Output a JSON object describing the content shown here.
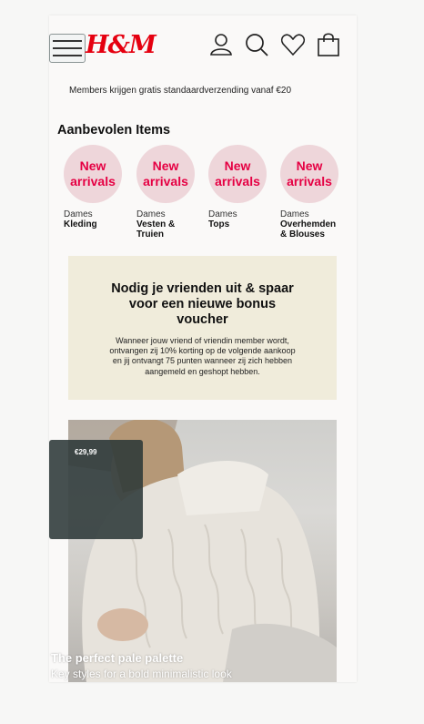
{
  "header": {
    "logo": "H&M",
    "icons": [
      "menu-icon",
      "account-icon",
      "search-icon",
      "heart-icon",
      "shopping-bag-icon"
    ]
  },
  "promo_text": "Members krijgen gratis standaardverzending vanaf €20",
  "recommended": {
    "title": "Aanbevolen Items",
    "items": [
      {
        "badge_line1": "New",
        "badge_line2": "arrivals",
        "category": "Dames",
        "name": "Kleding"
      },
      {
        "badge_line1": "New",
        "badge_line2": "arrivals",
        "category": "Dames",
        "name": "Vesten & Truien"
      },
      {
        "badge_line1": "New",
        "badge_line2": "arrivals",
        "category": "Dames",
        "name": "Tops"
      },
      {
        "badge_line1": "New",
        "badge_line2": "arrivals",
        "category": "Dames",
        "name": "Overhemden & Blouses"
      }
    ]
  },
  "banner": {
    "title": "Nodig je vrienden uit & spaar voor een nieuwe bonus voucher",
    "body": "Wanneer jouw vriend of vriendin member wordt, ontvangen zij 10% korting op de volgende aankoop en jij ontvangt 75 punten wanneer zij zich hebben aangemeld en geshopt hebben."
  },
  "hero": {
    "price": "€29,99",
    "title": "The perfect pale palette",
    "subtitle": "Key styles for a bold minimalistic look"
  },
  "colors": {
    "brand_red": "#e50010",
    "badge_bg": "#eed6da",
    "banner_bg": "#f0ecdb"
  }
}
